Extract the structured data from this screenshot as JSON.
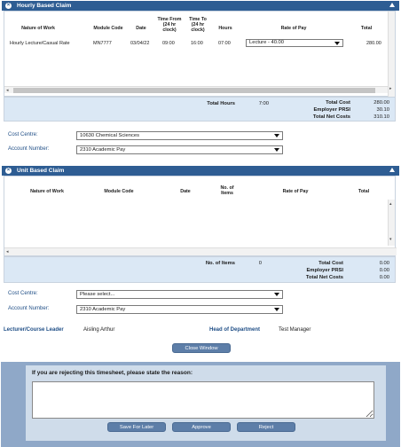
{
  "hourly": {
    "title": "Hourly Based Claim",
    "columns": [
      "Nature of Work",
      "Module Code",
      "Date",
      "Time From (24 hr clock)",
      "Time To (24 hr clock)",
      "Hours",
      "Rate of Pay",
      "Total"
    ],
    "row": {
      "nature": "Hourly Lecture/Casual Rate",
      "module": "MN7777",
      "date": "03/04/22",
      "from": "09:00",
      "to": "16:00",
      "hours": "07:00",
      "rate": "Lecture - 40.00",
      "total": "280.00"
    },
    "total_hours_label": "Total Hours",
    "total_hours": "7:00",
    "total_cost_label": "Total Cost",
    "total_cost": "280.00",
    "prsi_label": "Employer PRSI",
    "prsi": "30.10",
    "net_label": "Total Net Costs",
    "net": "310.10",
    "cost_centre_label": "Cost Centre:",
    "cost_centre": "10630 Chemical Sciences",
    "account_label": "Account Number:",
    "account": "2310 Academic Pay"
  },
  "unit": {
    "title": "Unit Based Claim",
    "columns": [
      "Nature of Work",
      "Module Code",
      "Date",
      "No. of Items",
      "Rate of Pay",
      "Total"
    ],
    "items_label": "No. of Items",
    "items": "0",
    "total_cost_label": "Total Cost",
    "total_cost": "0.00",
    "prsi_label": "Employer PRSI",
    "prsi": "0.00",
    "net_label": "Total Net Costs",
    "net": "0.00",
    "cost_centre_label": "Cost Centre:",
    "cost_centre": "Please select...",
    "account_label": "Account Number:",
    "account": "2310 Academic Pay"
  },
  "people": {
    "leader_label": "Lecturer/Course Leader",
    "leader": "Aisling Arthur",
    "hod_label": "Head of Department",
    "hod": "Test Manager"
  },
  "buttons": {
    "close": "Close Window",
    "save": "Save For Later",
    "approve": "Approve",
    "reject": "Reject"
  },
  "reject_prompt": "If you are rejecting this timesheet, please state the reason:",
  "colors": {
    "header": "#2e5d93",
    "summary": "#dbe8f5",
    "label": "#1f4e86",
    "button": "#5d7ea8"
  }
}
